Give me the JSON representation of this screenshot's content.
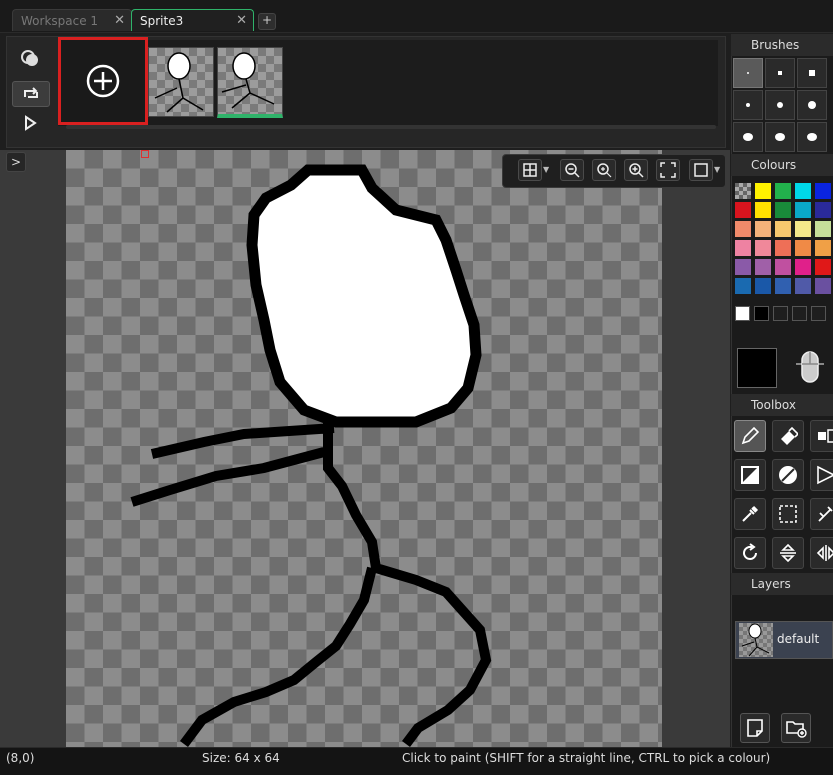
{
  "tabs": [
    {
      "label": "Workspace 1",
      "close": "✕",
      "active": false
    },
    {
      "label": "Sprite3",
      "close": "✕",
      "active": true
    }
  ],
  "tab_add": "+",
  "frames": {
    "add_icon": "plus-circle-icon",
    "count": 2,
    "selected": 2,
    "side_buttons": [
      "onion-skin-icon",
      "loop-icon",
      "play-icon"
    ]
  },
  "view_toolbar": {
    "icons": [
      "grid-icon",
      "zoom-out-icon",
      "zoom-reset-icon",
      "zoom-in-icon",
      "fit-icon",
      "frame-icon"
    ]
  },
  "panels": {
    "brushes": "Brushes",
    "colours": "Colours",
    "toolbox": "Toolbox",
    "layers": "Layers"
  },
  "colours": {
    "current": "#000000",
    "rows": [
      [
        "#f00a0a",
        "#fff200",
        "#22b14c",
        "#00d8e8",
        "#0a24e0"
      ],
      [
        "#d9141e",
        "#ffe000",
        "#198a3a",
        "#0aa8c8",
        "#2a2a9a"
      ],
      [
        "#f08a6a",
        "#f4b27a",
        "#f7c86e",
        "#f4e88a",
        "#c6df9a"
      ],
      [
        "#ee82a2",
        "#f0889a",
        "#ee6f57",
        "#f08a46",
        "#f0a046"
      ],
      [
        "#8a5aa8",
        "#a060a8",
        "#c050a0",
        "#e0208a",
        "#e01818"
      ],
      [
        "#1a6ab0",
        "#1a58a8",
        "#3060b0",
        "#505aa8",
        "#6a50a0"
      ]
    ],
    "custom": [
      "#ffffff",
      "#000000",
      "#1e1e1e",
      "#1e1e1e",
      "#1e1e1e"
    ]
  },
  "layers": [
    {
      "name": "default"
    }
  ],
  "status": {
    "position": "(8,0)",
    "size": "Size: 64 x 64",
    "hint": "Click to paint (SHIFT for a straight line, CTRL to pick a colour)"
  }
}
